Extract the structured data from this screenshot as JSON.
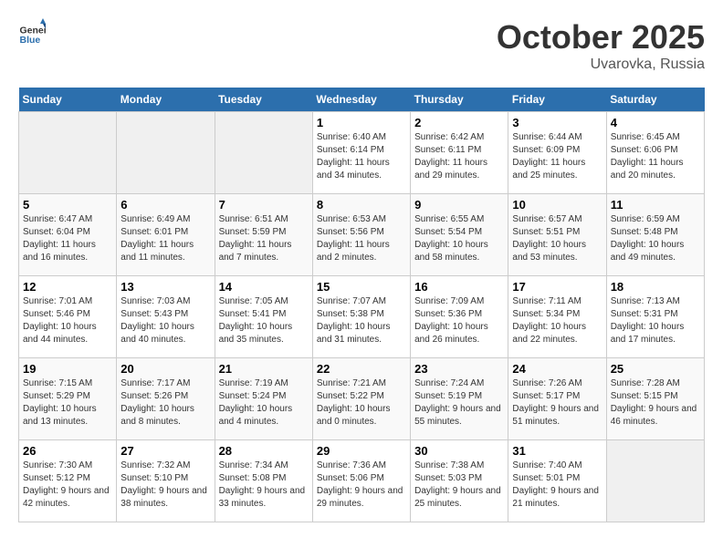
{
  "logo": {
    "general": "General",
    "blue": "Blue"
  },
  "title": {
    "month": "October 2025",
    "location": "Uvarovka, Russia"
  },
  "weekdays": [
    "Sunday",
    "Monday",
    "Tuesday",
    "Wednesday",
    "Thursday",
    "Friday",
    "Saturday"
  ],
  "weeks": [
    [
      {
        "day": "",
        "sunrise": "",
        "sunset": "",
        "daylight": ""
      },
      {
        "day": "",
        "sunrise": "",
        "sunset": "",
        "daylight": ""
      },
      {
        "day": "",
        "sunrise": "",
        "sunset": "",
        "daylight": ""
      },
      {
        "day": "1",
        "sunrise": "Sunrise: 6:40 AM",
        "sunset": "Sunset: 6:14 PM",
        "daylight": "Daylight: 11 hours and 34 minutes."
      },
      {
        "day": "2",
        "sunrise": "Sunrise: 6:42 AM",
        "sunset": "Sunset: 6:11 PM",
        "daylight": "Daylight: 11 hours and 29 minutes."
      },
      {
        "day": "3",
        "sunrise": "Sunrise: 6:44 AM",
        "sunset": "Sunset: 6:09 PM",
        "daylight": "Daylight: 11 hours and 25 minutes."
      },
      {
        "day": "4",
        "sunrise": "Sunrise: 6:45 AM",
        "sunset": "Sunset: 6:06 PM",
        "daylight": "Daylight: 11 hours and 20 minutes."
      }
    ],
    [
      {
        "day": "5",
        "sunrise": "Sunrise: 6:47 AM",
        "sunset": "Sunset: 6:04 PM",
        "daylight": "Daylight: 11 hours and 16 minutes."
      },
      {
        "day": "6",
        "sunrise": "Sunrise: 6:49 AM",
        "sunset": "Sunset: 6:01 PM",
        "daylight": "Daylight: 11 hours and 11 minutes."
      },
      {
        "day": "7",
        "sunrise": "Sunrise: 6:51 AM",
        "sunset": "Sunset: 5:59 PM",
        "daylight": "Daylight: 11 hours and 7 minutes."
      },
      {
        "day": "8",
        "sunrise": "Sunrise: 6:53 AM",
        "sunset": "Sunset: 5:56 PM",
        "daylight": "Daylight: 11 hours and 2 minutes."
      },
      {
        "day": "9",
        "sunrise": "Sunrise: 6:55 AM",
        "sunset": "Sunset: 5:54 PM",
        "daylight": "Daylight: 10 hours and 58 minutes."
      },
      {
        "day": "10",
        "sunrise": "Sunrise: 6:57 AM",
        "sunset": "Sunset: 5:51 PM",
        "daylight": "Daylight: 10 hours and 53 minutes."
      },
      {
        "day": "11",
        "sunrise": "Sunrise: 6:59 AM",
        "sunset": "Sunset: 5:48 PM",
        "daylight": "Daylight: 10 hours and 49 minutes."
      }
    ],
    [
      {
        "day": "12",
        "sunrise": "Sunrise: 7:01 AM",
        "sunset": "Sunset: 5:46 PM",
        "daylight": "Daylight: 10 hours and 44 minutes."
      },
      {
        "day": "13",
        "sunrise": "Sunrise: 7:03 AM",
        "sunset": "Sunset: 5:43 PM",
        "daylight": "Daylight: 10 hours and 40 minutes."
      },
      {
        "day": "14",
        "sunrise": "Sunrise: 7:05 AM",
        "sunset": "Sunset: 5:41 PM",
        "daylight": "Daylight: 10 hours and 35 minutes."
      },
      {
        "day": "15",
        "sunrise": "Sunrise: 7:07 AM",
        "sunset": "Sunset: 5:38 PM",
        "daylight": "Daylight: 10 hours and 31 minutes."
      },
      {
        "day": "16",
        "sunrise": "Sunrise: 7:09 AM",
        "sunset": "Sunset: 5:36 PM",
        "daylight": "Daylight: 10 hours and 26 minutes."
      },
      {
        "day": "17",
        "sunrise": "Sunrise: 7:11 AM",
        "sunset": "Sunset: 5:34 PM",
        "daylight": "Daylight: 10 hours and 22 minutes."
      },
      {
        "day": "18",
        "sunrise": "Sunrise: 7:13 AM",
        "sunset": "Sunset: 5:31 PM",
        "daylight": "Daylight: 10 hours and 17 minutes."
      }
    ],
    [
      {
        "day": "19",
        "sunrise": "Sunrise: 7:15 AM",
        "sunset": "Sunset: 5:29 PM",
        "daylight": "Daylight: 10 hours and 13 minutes."
      },
      {
        "day": "20",
        "sunrise": "Sunrise: 7:17 AM",
        "sunset": "Sunset: 5:26 PM",
        "daylight": "Daylight: 10 hours and 8 minutes."
      },
      {
        "day": "21",
        "sunrise": "Sunrise: 7:19 AM",
        "sunset": "Sunset: 5:24 PM",
        "daylight": "Daylight: 10 hours and 4 minutes."
      },
      {
        "day": "22",
        "sunrise": "Sunrise: 7:21 AM",
        "sunset": "Sunset: 5:22 PM",
        "daylight": "Daylight: 10 hours and 0 minutes."
      },
      {
        "day": "23",
        "sunrise": "Sunrise: 7:24 AM",
        "sunset": "Sunset: 5:19 PM",
        "daylight": "Daylight: 9 hours and 55 minutes."
      },
      {
        "day": "24",
        "sunrise": "Sunrise: 7:26 AM",
        "sunset": "Sunset: 5:17 PM",
        "daylight": "Daylight: 9 hours and 51 minutes."
      },
      {
        "day": "25",
        "sunrise": "Sunrise: 7:28 AM",
        "sunset": "Sunset: 5:15 PM",
        "daylight": "Daylight: 9 hours and 46 minutes."
      }
    ],
    [
      {
        "day": "26",
        "sunrise": "Sunrise: 7:30 AM",
        "sunset": "Sunset: 5:12 PM",
        "daylight": "Daylight: 9 hours and 42 minutes."
      },
      {
        "day": "27",
        "sunrise": "Sunrise: 7:32 AM",
        "sunset": "Sunset: 5:10 PM",
        "daylight": "Daylight: 9 hours and 38 minutes."
      },
      {
        "day": "28",
        "sunrise": "Sunrise: 7:34 AM",
        "sunset": "Sunset: 5:08 PM",
        "daylight": "Daylight: 9 hours and 33 minutes."
      },
      {
        "day": "29",
        "sunrise": "Sunrise: 7:36 AM",
        "sunset": "Sunset: 5:06 PM",
        "daylight": "Daylight: 9 hours and 29 minutes."
      },
      {
        "day": "30",
        "sunrise": "Sunrise: 7:38 AM",
        "sunset": "Sunset: 5:03 PM",
        "daylight": "Daylight: 9 hours and 25 minutes."
      },
      {
        "day": "31",
        "sunrise": "Sunrise: 7:40 AM",
        "sunset": "Sunset: 5:01 PM",
        "daylight": "Daylight: 9 hours and 21 minutes."
      },
      {
        "day": "",
        "sunrise": "",
        "sunset": "",
        "daylight": ""
      }
    ]
  ]
}
